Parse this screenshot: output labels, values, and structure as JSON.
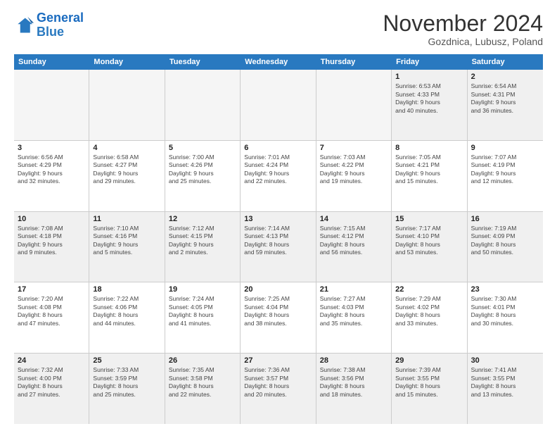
{
  "logo": {
    "line1": "General",
    "line2": "Blue"
  },
  "title": "November 2024",
  "subtitle": "Gozdnica, Lubusz, Poland",
  "header_days": [
    "Sunday",
    "Monday",
    "Tuesday",
    "Wednesday",
    "Thursday",
    "Friday",
    "Saturday"
  ],
  "weeks": [
    [
      {
        "day": "",
        "info": "",
        "empty": true
      },
      {
        "day": "",
        "info": "",
        "empty": true
      },
      {
        "day": "",
        "info": "",
        "empty": true
      },
      {
        "day": "",
        "info": "",
        "empty": true
      },
      {
        "day": "",
        "info": "",
        "empty": true
      },
      {
        "day": "1",
        "info": "Sunrise: 6:53 AM\nSunset: 4:33 PM\nDaylight: 9 hours\nand 40 minutes."
      },
      {
        "day": "2",
        "info": "Sunrise: 6:54 AM\nSunset: 4:31 PM\nDaylight: 9 hours\nand 36 minutes."
      }
    ],
    [
      {
        "day": "3",
        "info": "Sunrise: 6:56 AM\nSunset: 4:29 PM\nDaylight: 9 hours\nand 32 minutes."
      },
      {
        "day": "4",
        "info": "Sunrise: 6:58 AM\nSunset: 4:27 PM\nDaylight: 9 hours\nand 29 minutes."
      },
      {
        "day": "5",
        "info": "Sunrise: 7:00 AM\nSunset: 4:26 PM\nDaylight: 9 hours\nand 25 minutes."
      },
      {
        "day": "6",
        "info": "Sunrise: 7:01 AM\nSunset: 4:24 PM\nDaylight: 9 hours\nand 22 minutes."
      },
      {
        "day": "7",
        "info": "Sunrise: 7:03 AM\nSunset: 4:22 PM\nDaylight: 9 hours\nand 19 minutes."
      },
      {
        "day": "8",
        "info": "Sunrise: 7:05 AM\nSunset: 4:21 PM\nDaylight: 9 hours\nand 15 minutes."
      },
      {
        "day": "9",
        "info": "Sunrise: 7:07 AM\nSunset: 4:19 PM\nDaylight: 9 hours\nand 12 minutes."
      }
    ],
    [
      {
        "day": "10",
        "info": "Sunrise: 7:08 AM\nSunset: 4:18 PM\nDaylight: 9 hours\nand 9 minutes."
      },
      {
        "day": "11",
        "info": "Sunrise: 7:10 AM\nSunset: 4:16 PM\nDaylight: 9 hours\nand 5 minutes."
      },
      {
        "day": "12",
        "info": "Sunrise: 7:12 AM\nSunset: 4:15 PM\nDaylight: 9 hours\nand 2 minutes."
      },
      {
        "day": "13",
        "info": "Sunrise: 7:14 AM\nSunset: 4:13 PM\nDaylight: 8 hours\nand 59 minutes."
      },
      {
        "day": "14",
        "info": "Sunrise: 7:15 AM\nSunset: 4:12 PM\nDaylight: 8 hours\nand 56 minutes."
      },
      {
        "day": "15",
        "info": "Sunrise: 7:17 AM\nSunset: 4:10 PM\nDaylight: 8 hours\nand 53 minutes."
      },
      {
        "day": "16",
        "info": "Sunrise: 7:19 AM\nSunset: 4:09 PM\nDaylight: 8 hours\nand 50 minutes."
      }
    ],
    [
      {
        "day": "17",
        "info": "Sunrise: 7:20 AM\nSunset: 4:08 PM\nDaylight: 8 hours\nand 47 minutes."
      },
      {
        "day": "18",
        "info": "Sunrise: 7:22 AM\nSunset: 4:06 PM\nDaylight: 8 hours\nand 44 minutes."
      },
      {
        "day": "19",
        "info": "Sunrise: 7:24 AM\nSunset: 4:05 PM\nDaylight: 8 hours\nand 41 minutes."
      },
      {
        "day": "20",
        "info": "Sunrise: 7:25 AM\nSunset: 4:04 PM\nDaylight: 8 hours\nand 38 minutes."
      },
      {
        "day": "21",
        "info": "Sunrise: 7:27 AM\nSunset: 4:03 PM\nDaylight: 8 hours\nand 35 minutes."
      },
      {
        "day": "22",
        "info": "Sunrise: 7:29 AM\nSunset: 4:02 PM\nDaylight: 8 hours\nand 33 minutes."
      },
      {
        "day": "23",
        "info": "Sunrise: 7:30 AM\nSunset: 4:01 PM\nDaylight: 8 hours\nand 30 minutes."
      }
    ],
    [
      {
        "day": "24",
        "info": "Sunrise: 7:32 AM\nSunset: 4:00 PM\nDaylight: 8 hours\nand 27 minutes."
      },
      {
        "day": "25",
        "info": "Sunrise: 7:33 AM\nSunset: 3:59 PM\nDaylight: 8 hours\nand 25 minutes."
      },
      {
        "day": "26",
        "info": "Sunrise: 7:35 AM\nSunset: 3:58 PM\nDaylight: 8 hours\nand 22 minutes."
      },
      {
        "day": "27",
        "info": "Sunrise: 7:36 AM\nSunset: 3:57 PM\nDaylight: 8 hours\nand 20 minutes."
      },
      {
        "day": "28",
        "info": "Sunrise: 7:38 AM\nSunset: 3:56 PM\nDaylight: 8 hours\nand 18 minutes."
      },
      {
        "day": "29",
        "info": "Sunrise: 7:39 AM\nSunset: 3:55 PM\nDaylight: 8 hours\nand 15 minutes."
      },
      {
        "day": "30",
        "info": "Sunrise: 7:41 AM\nSunset: 3:55 PM\nDaylight: 8 hours\nand 13 minutes."
      }
    ]
  ]
}
